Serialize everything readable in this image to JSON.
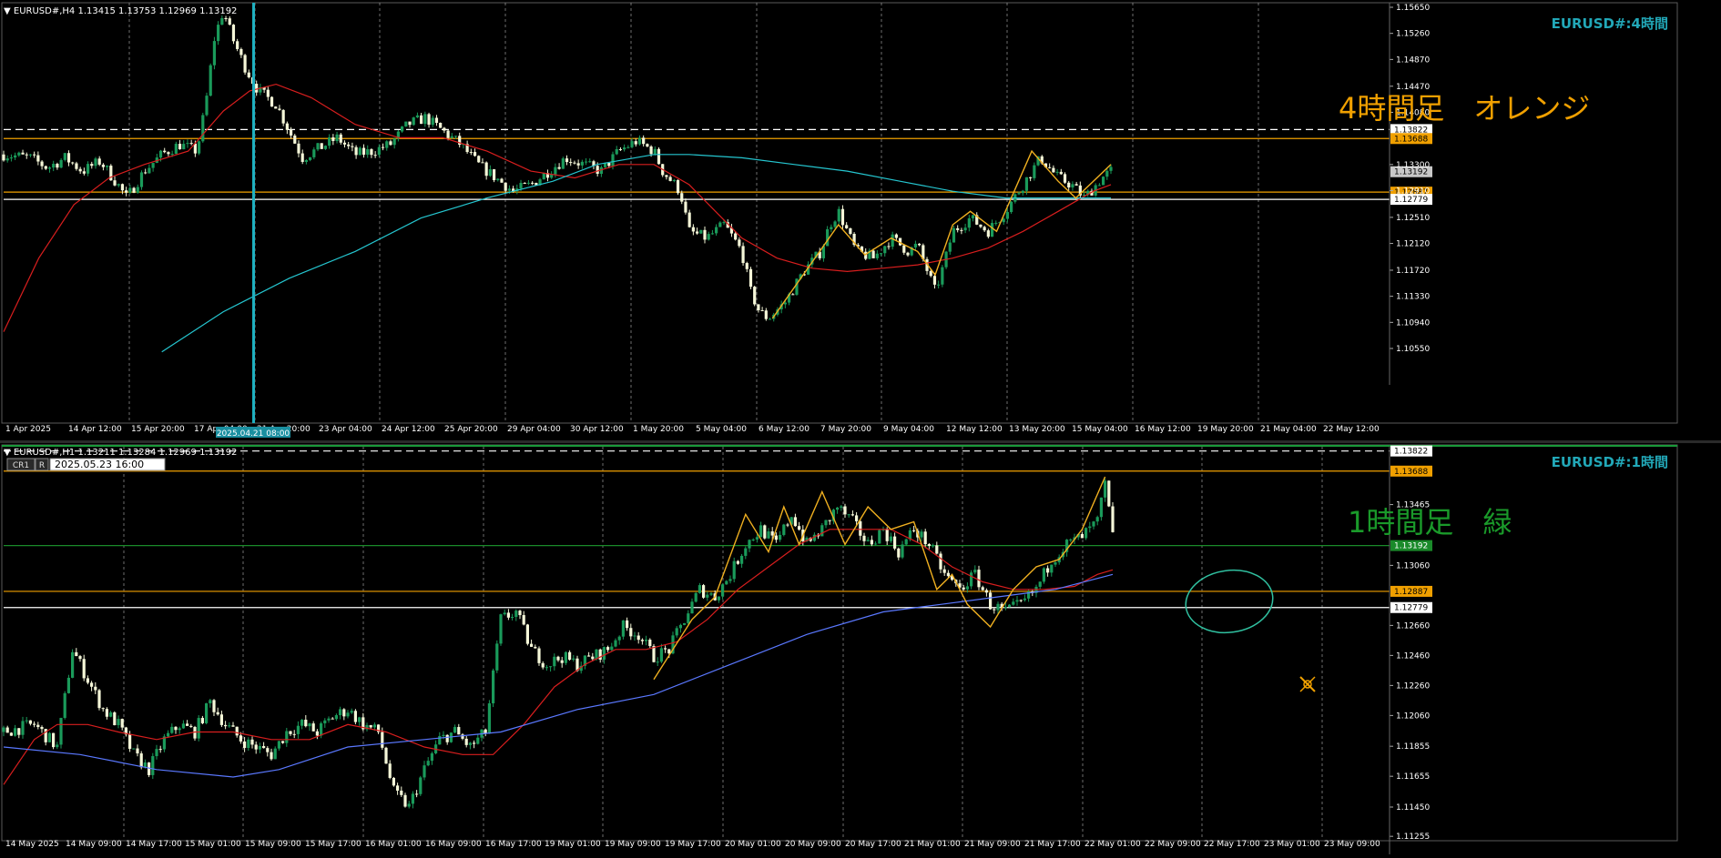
{
  "colors": {
    "background": "#000000",
    "bull": "#1a9a5a",
    "bear": "#f5f7d8",
    "ma_red": "#d81e1e",
    "ma_cyan": "#25c6d0",
    "ma_blue": "#5a78ff",
    "zigzag": "#f0b020",
    "orange_line": "#f0a000",
    "white_line": "#ffffff",
    "green_line": "#1a8a2a",
    "title_teal": "#22a8b8",
    "annot_orange": "#f0a000",
    "annot_green": "#1a9a2a",
    "circle_teal": "#30c0a0",
    "grid": "#c8c8c8",
    "axis_text": "#ffffff"
  },
  "chart_data": [
    {
      "type": "candlestick",
      "symbol_label": "EURUSD#,H4",
      "ohlc_header": "1.13415 1.13753 1.12969 1.13192",
      "title": "EURUSD#:4時間",
      "annotation": "4時間足　オレンジ",
      "ylim": [
        1.1055,
        1.1565
      ],
      "y_ticks": [
        "1.15650",
        "1.15260",
        "1.14870",
        "1.14470",
        "1.14080",
        "1.13300",
        "1.12910",
        "1.12510",
        "1.12120",
        "1.11720",
        "1.11330",
        "1.10940",
        "1.10550"
      ],
      "x_ticks": [
        "1 Apr 2025",
        "14 Apr 12:00",
        "15 Apr 20:00",
        "17 Apr 04:00",
        "21 Apr 20:00",
        "23 Apr 04:00",
        "24 Apr 12:00",
        "25 Apr 20:00",
        "29 Apr 04:00",
        "30 Apr 12:00",
        "1 May 20:00",
        "5 May 04:00",
        "6 May 12:00",
        "7 May 20:00",
        "9 May 04:00",
        "12 May 12:00",
        "13 May 20:00",
        "15 May 04:00",
        "16 May 12:00",
        "19 May 20:00",
        "21 May 04:00",
        "22 May 12:00"
      ],
      "crosshair_label": "2025.04.21 08:00",
      "horizontal_levels": [
        {
          "value": 1.13822,
          "label": "1.13822",
          "style": "dashed-white"
        },
        {
          "value": 1.13688,
          "label": "1.13688",
          "style": "orange"
        },
        {
          "value": 1.13192,
          "label": "1.13192",
          "style": "bid"
        },
        {
          "value": 1.12887,
          "label": "1.12887",
          "style": "orange"
        },
        {
          "value": 1.12779,
          "label": "1.12779",
          "style": "white"
        }
      ],
      "close_path": [
        [
          0,
          1.1345
        ],
        [
          6,
          1.134
        ],
        [
          10,
          1.1325
        ],
        [
          14,
          1.134
        ],
        [
          18,
          1.132
        ],
        [
          22,
          1.1335
        ],
        [
          26,
          1.13
        ],
        [
          28,
          1.128
        ],
        [
          32,
          1.132
        ],
        [
          36,
          1.1345
        ],
        [
          40,
          1.136
        ],
        [
          44,
          1.135
        ],
        [
          46,
          1.142
        ],
        [
          48,
          1.152
        ],
        [
          50,
          1.156
        ],
        [
          52,
          1.152
        ],
        [
          55,
          1.1475
        ],
        [
          58,
          1.144
        ],
        [
          62,
          1.142
        ],
        [
          65,
          1.138
        ],
        [
          68,
          1.134
        ],
        [
          72,
          1.1355
        ],
        [
          76,
          1.137
        ],
        [
          80,
          1.1345
        ],
        [
          84,
          1.135
        ],
        [
          88,
          1.136
        ],
        [
          92,
          1.139
        ],
        [
          96,
          1.14
        ],
        [
          100,
          1.138
        ],
        [
          104,
          1.136
        ],
        [
          108,
          1.133
        ],
        [
          112,
          1.131
        ],
        [
          116,
          1.129
        ],
        [
          120,
          1.13
        ],
        [
          124,
          1.132
        ],
        [
          128,
          1.134
        ],
        [
          132,
          1.133
        ],
        [
          136,
          1.132
        ],
        [
          140,
          1.135
        ],
        [
          144,
          1.1365
        ],
        [
          148,
          1.135
        ],
        [
          150,
          1.132
        ],
        [
          154,
          1.129
        ],
        [
          156,
          1.123
        ],
        [
          160,
          1.122
        ],
        [
          164,
          1.124
        ],
        [
          168,
          1.12
        ],
        [
          170,
          1.114
        ],
        [
          172,
          1.111
        ],
        [
          174,
          1.11
        ],
        [
          178,
          1.1125
        ],
        [
          182,
          1.117
        ],
        [
          186,
          1.12
        ],
        [
          188,
          1.124
        ],
        [
          190,
          1.126
        ],
        [
          194,
          1.12
        ],
        [
          198,
          1.119
        ],
        [
          202,
          1.122
        ],
        [
          206,
          1.12
        ],
        [
          208,
          1.121
        ],
        [
          212,
          1.114
        ],
        [
          214,
          1.118
        ],
        [
          216,
          1.123
        ],
        [
          220,
          1.125
        ],
        [
          224,
          1.123
        ],
        [
          228,
          1.126
        ],
        [
          232,
          1.13
        ],
        [
          236,
          1.134
        ],
        [
          240,
          1.131
        ],
        [
          243,
          1.13
        ],
        [
          246,
          1.128
        ],
        [
          250,
          1.131
        ],
        [
          252,
          1.132
        ]
      ],
      "ma_red": [
        [
          0,
          1.108
        ],
        [
          8,
          1.119
        ],
        [
          16,
          1.127
        ],
        [
          24,
          1.131
        ],
        [
          32,
          1.133
        ],
        [
          42,
          1.135
        ],
        [
          50,
          1.141
        ],
        [
          56,
          1.144
        ],
        [
          62,
          1.145
        ],
        [
          70,
          1.143
        ],
        [
          80,
          1.139
        ],
        [
          90,
          1.137
        ],
        [
          100,
          1.137
        ],
        [
          110,
          1.135
        ],
        [
          120,
          1.132
        ],
        [
          130,
          1.131
        ],
        [
          140,
          1.133
        ],
        [
          148,
          1.133
        ],
        [
          156,
          1.13
        ],
        [
          162,
          1.126
        ],
        [
          168,
          1.122
        ],
        [
          176,
          1.119
        ],
        [
          184,
          1.1175
        ],
        [
          192,
          1.117
        ],
        [
          200,
          1.1175
        ],
        [
          208,
          1.118
        ],
        [
          216,
          1.119
        ],
        [
          224,
          1.1205
        ],
        [
          232,
          1.123
        ],
        [
          240,
          1.126
        ],
        [
          248,
          1.129
        ],
        [
          252,
          1.13
        ]
      ],
      "ma_cyan": [
        [
          36,
          1.105
        ],
        [
          50,
          1.111
        ],
        [
          65,
          1.116
        ],
        [
          80,
          1.12
        ],
        [
          95,
          1.125
        ],
        [
          110,
          1.128
        ],
        [
          125,
          1.1305
        ],
        [
          135,
          1.133
        ],
        [
          148,
          1.1345
        ],
        [
          156,
          1.1345
        ],
        [
          168,
          1.134
        ],
        [
          180,
          1.133
        ],
        [
          192,
          1.132
        ],
        [
          204,
          1.1305
        ],
        [
          216,
          1.129
        ],
        [
          228,
          1.128
        ],
        [
          240,
          1.128
        ],
        [
          252,
          1.128
        ]
      ],
      "zigzag": [
        [
          175,
          1.11
        ],
        [
          190,
          1.124
        ],
        [
          196,
          1.1195
        ],
        [
          202,
          1.122
        ],
        [
          208,
          1.12
        ],
        [
          212,
          1.1165
        ],
        [
          216,
          1.124
        ],
        [
          220,
          1.126
        ],
        [
          226,
          1.123
        ],
        [
          234,
          1.135
        ],
        [
          240,
          1.1305
        ],
        [
          244,
          1.128
        ],
        [
          248,
          1.1305
        ],
        [
          252,
          1.133
        ]
      ]
    },
    {
      "type": "candlestick",
      "symbol_label": "EURUSD#,H1",
      "ohlc_header": "1.13211 1.13284 1.12969 1.13192",
      "title": "EURUSD#:1時間",
      "annotation": "1時間足　緑",
      "toolbar_buttons": [
        "CR1",
        "R"
      ],
      "date_box": "2025.05.23 16:00",
      "ylim": [
        1.1125,
        1.1382
      ],
      "y_ticks": [
        "1.13465",
        "1.13060",
        "1.12660",
        "1.12460",
        "1.12260",
        "1.12060",
        "1.11855",
        "1.11655",
        "1.11450",
        "1.11255"
      ],
      "x_ticks": [
        "14 May 2025",
        "14 May 09:00",
        "14 May 17:00",
        "15 May 01:00",
        "15 May 09:00",
        "15 May 17:00",
        "16 May 01:00",
        "16 May 09:00",
        "16 May 17:00",
        "19 May 01:00",
        "19 May 09:00",
        "19 May 17:00",
        "20 May 01:00",
        "20 May 09:00",
        "20 May 17:00",
        "21 May 01:00",
        "21 May 09:00",
        "21 May 17:00",
        "22 May 01:00",
        "22 May 09:00",
        "22 May 17:00",
        "23 May 01:00",
        "23 May 09:00"
      ],
      "horizontal_levels": [
        {
          "value": 1.13822,
          "label": "1.13822",
          "style": "dashed-white"
        },
        {
          "value": 1.13688,
          "label": "1.13688",
          "style": "orange"
        },
        {
          "value": 1.13192,
          "label": "1.13192",
          "style": "green"
        },
        {
          "value": 1.12887,
          "label": "1.12887",
          "style": "orange"
        },
        {
          "value": 1.12779,
          "label": "1.12779",
          "style": "white"
        }
      ],
      "close_path": [
        [
          0,
          1.1195
        ],
        [
          8,
          1.12
        ],
        [
          14,
          1.1185
        ],
        [
          18,
          1.125
        ],
        [
          22,
          1.123
        ],
        [
          26,
          1.121
        ],
        [
          30,
          1.12
        ],
        [
          34,
          1.118
        ],
        [
          38,
          1.117
        ],
        [
          42,
          1.119
        ],
        [
          46,
          1.12
        ],
        [
          50,
          1.1195
        ],
        [
          54,
          1.1215
        ],
        [
          58,
          1.12
        ],
        [
          62,
          1.119
        ],
        [
          66,
          1.1185
        ],
        [
          70,
          1.118
        ],
        [
          74,
          1.1195
        ],
        [
          78,
          1.12
        ],
        [
          82,
          1.1195
        ],
        [
          86,
          1.1205
        ],
        [
          90,
          1.121
        ],
        [
          94,
          1.12
        ],
        [
          98,
          1.1195
        ],
        [
          102,
          1.1155
        ],
        [
          106,
          1.1145
        ],
        [
          110,
          1.117
        ],
        [
          114,
          1.119
        ],
        [
          118,
          1.1195
        ],
        [
          122,
          1.1185
        ],
        [
          126,
          1.1195
        ],
        [
          130,
          1.127
        ],
        [
          134,
          1.1275
        ],
        [
          138,
          1.125
        ],
        [
          142,
          1.124
        ],
        [
          146,
          1.1245
        ],
        [
          150,
          1.124
        ],
        [
          154,
          1.1245
        ],
        [
          158,
          1.125
        ],
        [
          162,
          1.1265
        ],
        [
          166,
          1.126
        ],
        [
          170,
          1.1245
        ],
        [
          174,
          1.125
        ],
        [
          178,
          1.127
        ],
        [
          182,
          1.129
        ],
        [
          186,
          1.1285
        ],
        [
          190,
          1.13
        ],
        [
          194,
          1.132
        ],
        [
          198,
          1.133
        ],
        [
          202,
          1.132
        ],
        [
          206,
          1.134
        ],
        [
          210,
          1.132
        ],
        [
          214,
          1.133
        ],
        [
          218,
          1.1345
        ],
        [
          222,
          1.1335
        ],
        [
          226,
          1.132
        ],
        [
          230,
          1.133
        ],
        [
          234,
          1.1315
        ],
        [
          238,
          1.133
        ],
        [
          242,
          1.132
        ],
        [
          246,
          1.13
        ],
        [
          250,
          1.129
        ],
        [
          254,
          1.13
        ],
        [
          258,
          1.128
        ],
        [
          262,
          1.1275
        ],
        [
          266,
          1.128
        ],
        [
          270,
          1.129
        ],
        [
          274,
          1.131
        ],
        [
          278,
          1.132
        ],
        [
          282,
          1.1325
        ],
        [
          286,
          1.1335
        ],
        [
          288,
          1.136
        ],
        [
          290,
          1.1325
        ]
      ],
      "ma_red": [
        [
          0,
          1.116
        ],
        [
          8,
          1.119
        ],
        [
          14,
          1.12
        ],
        [
          22,
          1.12
        ],
        [
          30,
          1.1195
        ],
        [
          40,
          1.119
        ],
        [
          50,
          1.1195
        ],
        [
          60,
          1.1195
        ],
        [
          70,
          1.119
        ],
        [
          80,
          1.119
        ],
        [
          90,
          1.12
        ],
        [
          100,
          1.1195
        ],
        [
          110,
          1.1185
        ],
        [
          120,
          1.118
        ],
        [
          128,
          1.118
        ],
        [
          136,
          1.12
        ],
        [
          144,
          1.1225
        ],
        [
          152,
          1.124
        ],
        [
          160,
          1.125
        ],
        [
          168,
          1.125
        ],
        [
          176,
          1.1255
        ],
        [
          184,
          1.127
        ],
        [
          192,
          1.129
        ],
        [
          200,
          1.1305
        ],
        [
          208,
          1.132
        ],
        [
          216,
          1.133
        ],
        [
          224,
          1.133
        ],
        [
          232,
          1.133
        ],
        [
          240,
          1.132
        ],
        [
          248,
          1.1305
        ],
        [
          256,
          1.1295
        ],
        [
          264,
          1.129
        ],
        [
          272,
          1.129
        ],
        [
          280,
          1.1292
        ],
        [
          286,
          1.13
        ],
        [
          290,
          1.1303
        ]
      ],
      "ma_blue": [
        [
          0,
          1.1185
        ],
        [
          20,
          1.118
        ],
        [
          40,
          1.117
        ],
        [
          60,
          1.1165
        ],
        [
          72,
          1.117
        ],
        [
          90,
          1.1185
        ],
        [
          110,
          1.119
        ],
        [
          130,
          1.1195
        ],
        [
          150,
          1.121
        ],
        [
          170,
          1.122
        ],
        [
          190,
          1.124
        ],
        [
          210,
          1.126
        ],
        [
          230,
          1.1275
        ],
        [
          245,
          1.128
        ],
        [
          260,
          1.1285
        ],
        [
          275,
          1.129
        ],
        [
          290,
          1.13
        ]
      ],
      "zigzag": [
        [
          170,
          1.123
        ],
        [
          180,
          1.127
        ],
        [
          186,
          1.1285
        ],
        [
          194,
          1.134
        ],
        [
          200,
          1.1315
        ],
        [
          204,
          1.1345
        ],
        [
          208,
          1.132
        ],
        [
          214,
          1.1355
        ],
        [
          220,
          1.132
        ],
        [
          226,
          1.1345
        ],
        [
          232,
          1.133
        ],
        [
          238,
          1.1335
        ],
        [
          244,
          1.129
        ],
        [
          248,
          1.13
        ],
        [
          252,
          1.128
        ],
        [
          258,
          1.1265
        ],
        [
          264,
          1.129
        ],
        [
          270,
          1.1305
        ],
        [
          276,
          1.131
        ],
        [
          282,
          1.133
        ],
        [
          288,
          1.1365
        ]
      ]
    }
  ]
}
